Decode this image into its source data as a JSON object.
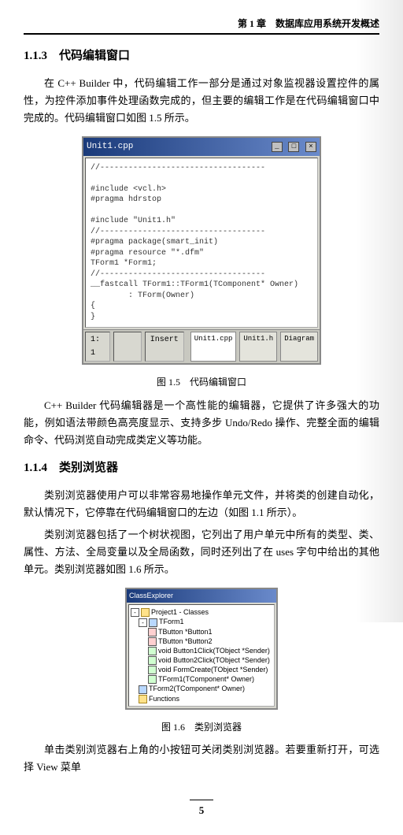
{
  "header": {
    "chapter": "第 1 章　数据库应用系统开发概述"
  },
  "s113": {
    "heading": "1.1.3　代码编辑窗口",
    "p1": "在 C++ Builder 中，代码编辑工作一部分是通过对象监视器设置控件的属性，为控件添加事件处理函数完成的，但主要的编辑工作是在代码编辑窗口中完成的。代码编辑窗口如图 1.5 所示。",
    "p2": "C++ Builder 代码编辑器是一个高性能的编辑器，它提供了许多强大的功能，例如语法带颜色高亮度显示、支持多步 Undo/Redo 操作、完整全面的编辑命令、代码浏览自动完成类定义等功能。"
  },
  "s114": {
    "heading": "1.1.4　类别浏览器",
    "p1": "类别浏览器使用户可以非常容易地操作单元文件，并将类的创建自动化，默认情况下，它停靠在代码编辑窗口的左边（如图 1.1 所示）。",
    "p2": "类别浏览器包括了一个树状视图，它列出了用户单元中所有的类型、类、属性、方法、全局变量以及全局函数，同时还列出了在 uses 字句中给出的其他单元。类别浏览器如图 1.6 所示。",
    "p3": "单击类别浏览器右上角的小按钮可关闭类别浏览器。若要重新打开，可选择 View 菜单"
  },
  "fig15": {
    "title": "Unit1.cpp",
    "code_lines": [
      "//-----------------------------------",
      "",
      "#include <vcl.h>",
      "#pragma hdrstop",
      "",
      "#include \"Unit1.h\"",
      "//-----------------------------------",
      "#pragma package(smart_init)",
      "#pragma resource \"*.dfm\"",
      "TForm1 *Form1;",
      "//-----------------------------------",
      "__fastcall TForm1::TForm1(TComponent* Owner)",
      "        : TForm(Owner)",
      "{",
      "}"
    ],
    "status": {
      "pos": "1: 1",
      "mode": "Insert"
    },
    "tabs": [
      "Unit1.cpp",
      "Unit1.h",
      "Diagram"
    ],
    "caption": "图 1.5　代码编辑窗口"
  },
  "fig16": {
    "title": "ClassExplorer",
    "nodes": {
      "root": "Project1 - Classes",
      "tform1": "TForm1",
      "btn1": "TButton *Button1",
      "btn2": "TButton *Button2",
      "click1": "void Button1Click(TObject *Sender)",
      "click2": "void Button2Click(TObject *Sender)",
      "formcreate": "void FormCreate(TObject *Sender)",
      "ctor": "TForm1(TComponent* Owner)",
      "ctor2": "TForm2(TComponent* Owner)",
      "functions": "Functions"
    },
    "caption": "图 1.6　类别浏览器"
  },
  "page": "5"
}
